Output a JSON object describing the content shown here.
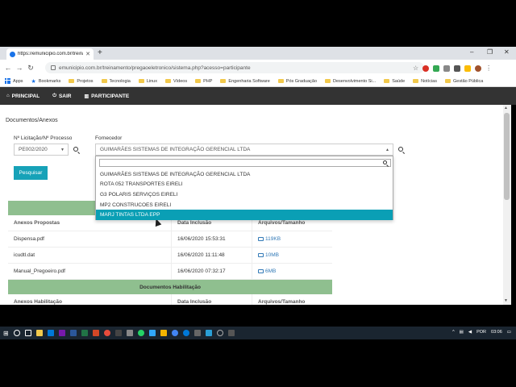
{
  "browser": {
    "tab_title": "https://emunicipio.com.br/treina",
    "url": "emunicipio.com.br/treinamento/pregaoeletronico/sistema.php?acesso=participante",
    "bookmarks": [
      "Apps",
      "Bookmarks",
      "Projetos",
      "Tecnologia",
      "Linux",
      "Vídeos",
      "PHP",
      "Engenharia Software",
      "Pós Graduação",
      "Desenvolvimento Si...",
      "Saúde",
      "Notícias",
      "Gestão Pública"
    ]
  },
  "nav": {
    "principal": "PRINCIPAL",
    "sair": "SAIR",
    "participante": "PARTICIPANTE"
  },
  "page": {
    "section_title": "Documentos/Anexos",
    "licitacao_label": "Nº Licitação/Nº Processo",
    "licitacao_value": "PE002/2020",
    "fornecedor_label": "Fornecedor",
    "fornecedor_value": "GUIMARÃES SISTEMAS DE INTEGRAÇÃO GERENCIAL LTDA",
    "pesquisar": "Pesquisar"
  },
  "dropdown": {
    "options": [
      "GUIMARÃES SISTEMAS DE INTEGRAÇÃO GERENCIAL LTDA",
      "ROTA 052 TRANSPORTES EIRELI",
      "G3 POLARIS SERVIÇOS EIRELI",
      "MP2 CONSTRUCOES EIRELI",
      "MARJ TINTAS LTDA EPP"
    ],
    "highlighted": "MARJ TINTAS LTDA EPP"
  },
  "table": {
    "headers": [
      "Anexos Propostas",
      "Data Inclusão",
      "Arquivos/Tamanho"
    ],
    "rows": [
      {
        "name": "Dispensa.pdf",
        "date": "16/06/2020 15:53:31",
        "size": "119KB"
      },
      {
        "name": "icudtl.dat",
        "date": "16/06/2020 11:11:48",
        "size": "10MB"
      },
      {
        "name": "Manual_Pregoeiro.pdf",
        "date": "16/06/2020 07:32:17",
        "size": "6MB"
      }
    ],
    "hab_title": "Documentos Habilitação",
    "hab_headers": [
      "Anexos Habilitação",
      "Data Inclusão",
      "Arquivos/Tamanho"
    ]
  },
  "taskbar": {
    "lang": "POR",
    "time": "03:06"
  }
}
